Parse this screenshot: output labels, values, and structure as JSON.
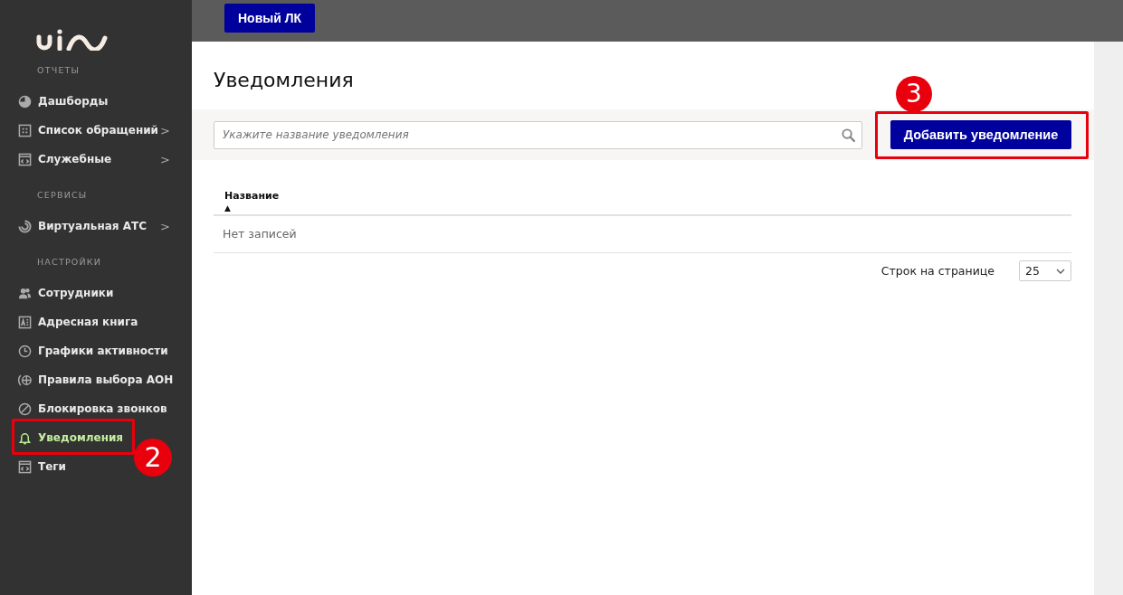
{
  "top_bar": {
    "button": "Новый ЛК"
  },
  "sidebar": {
    "sections": [
      {
        "title": "ОТЧЕТЫ",
        "items": [
          {
            "label": "Дашборды",
            "selected": false
          },
          {
            "label": "Список обращений",
            "arrow": ">",
            "selected": false
          },
          {
            "label": "Служебные",
            "arrow": ">",
            "selected": false
          }
        ]
      },
      {
        "title": "СЕРВИСЫ",
        "items": [
          {
            "label": "Виртуальная АТС",
            "arrow": ">",
            "selected": false
          }
        ]
      },
      {
        "title": "НАСТРОЙКИ",
        "items": [
          {
            "label": "Сотрудники",
            "selected": false
          },
          {
            "label": "Адресная книга",
            "selected": false
          },
          {
            "label": "Графики активности",
            "selected": false
          },
          {
            "label": "Правила выбора АОН",
            "selected": false
          },
          {
            "label": "Блокировка звонков",
            "selected": false
          },
          {
            "label": "Уведомления",
            "selected": true,
            "annotation": "2"
          },
          {
            "label": "Теги",
            "selected": false
          }
        ]
      }
    ]
  },
  "page": {
    "title": "Уведомления",
    "search": {
      "placeholder": "Укажите название уведомления"
    },
    "add_button": {
      "label": "Добавить уведомление",
      "annotation": "3"
    },
    "table": {
      "columns": [
        {
          "label": "Название",
          "sort": "▲"
        }
      ],
      "empty_text": "Нет записей"
    },
    "pagination": {
      "label": "Строк на странице",
      "value": "25"
    }
  }
}
